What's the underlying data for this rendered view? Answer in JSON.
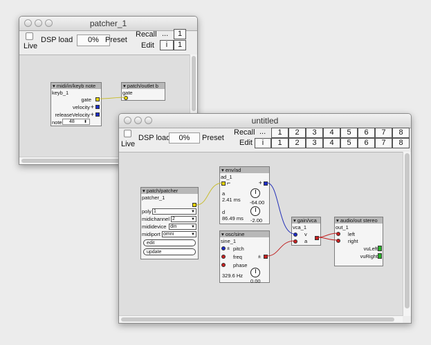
{
  "win1": {
    "title": "patcher_1",
    "live_label": "Live",
    "dsp_label": "DSP load",
    "dsp_value": "0%",
    "preset_label": "Preset",
    "recall_label": "Recall",
    "edit_label": "Edit",
    "ellipsis": "...",
    "i_label": "i",
    "recall_cells": [
      "1"
    ],
    "edit_cells": [
      "1"
    ],
    "objects": {
      "midi": {
        "type": "midi/in/keyb note",
        "name": "keyb_1",
        "gate": "gate",
        "velocity": "velocity",
        "release": "releaseVelocity",
        "note_label": "note",
        "note_value": "48"
      },
      "outlet": {
        "type": "patch/outlet b",
        "name": "gate"
      }
    }
  },
  "win2": {
    "title": "untitled",
    "live_label": "Live",
    "dsp_label": "DSP load",
    "dsp_value": "0%",
    "preset_label": "Preset",
    "recall_label": "Recall",
    "edit_label": "Edit",
    "ellipsis": "...",
    "i_label": "i",
    "recall_cells": [
      "1",
      "2",
      "3",
      "4",
      "5",
      "6",
      "7",
      "8"
    ],
    "edit_cells": [
      "1",
      "2",
      "3",
      "4",
      "5",
      "6",
      "7",
      "8"
    ],
    "objects": {
      "patcher": {
        "type": "patch/patcher",
        "name": "patcher_1",
        "poly_label": "poly",
        "poly_value": "1",
        "midichannel_label": "midichannel",
        "midichannel_value": "2",
        "mididevice_label": "mididevice",
        "mididevice_value": "din",
        "midiport_label": "midiport",
        "midiport_value": "omni",
        "edit_btn": "edit",
        "update_btn": "update"
      },
      "env": {
        "type": "env/ad",
        "name": "ad_1",
        "a_label": "a",
        "a_value": "2.41 ms",
        "a_knob": "-64.00",
        "d_label": "d",
        "d_value": "86.49 ms",
        "d_knob": "-2.00"
      },
      "osc": {
        "type": "osc/sine",
        "name": "sine_1",
        "pitch": "pitch",
        "freq": "freq",
        "phase": "phase",
        "freq_value": "329.6 Hz",
        "knob": "0.00"
      },
      "vca": {
        "type": "gain/vca",
        "name": "vca_1",
        "v": "v",
        "a": "a"
      },
      "out": {
        "type": "audio/out stereo",
        "name": "out_1",
        "left": "left",
        "right": "right",
        "vuleft": "vuLeft",
        "vuright": "vuRight"
      }
    }
  }
}
